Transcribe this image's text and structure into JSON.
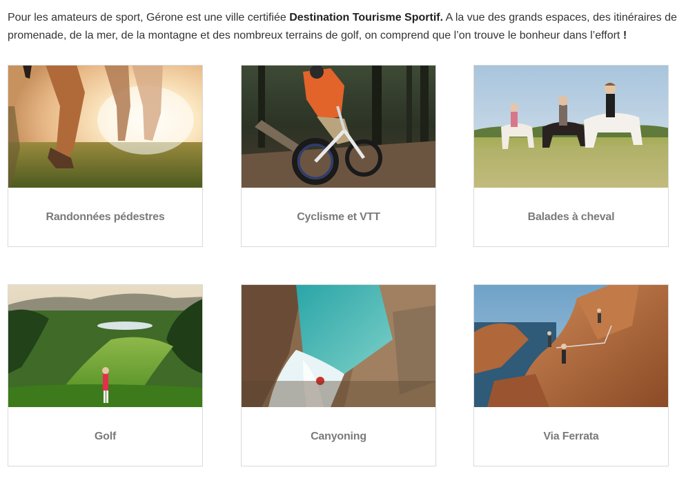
{
  "intro": {
    "text_before": "Pour les amateurs de sport, Gérone est une ville certifiée ",
    "bold_1": "Destination Tourisme Sportif.",
    "text_middle": " A la vue des grands espaces, des itinéraires de promenade, de la mer, de la montagne et des nombreux terrains de golf, on comprend que l’on trouve le bonheur dans l’effort ",
    "bold_2": "!"
  },
  "activities": [
    {
      "label": "Randonnées pédestres",
      "icon": "hiking-photo"
    },
    {
      "label": "Cyclisme et VTT",
      "icon": "mountain-bike-photo"
    },
    {
      "label": "Balades à cheval",
      "icon": "horse-riding-photo"
    },
    {
      "label": "Golf",
      "icon": "golf-photo"
    },
    {
      "label": "Canyoning",
      "icon": "canyoning-photo"
    },
    {
      "label": "Via Ferrata",
      "icon": "via-ferrata-photo"
    }
  ],
  "colors": {
    "text": "#333333",
    "label": "#7a7a7a",
    "card_border": "#d9d9d9"
  }
}
